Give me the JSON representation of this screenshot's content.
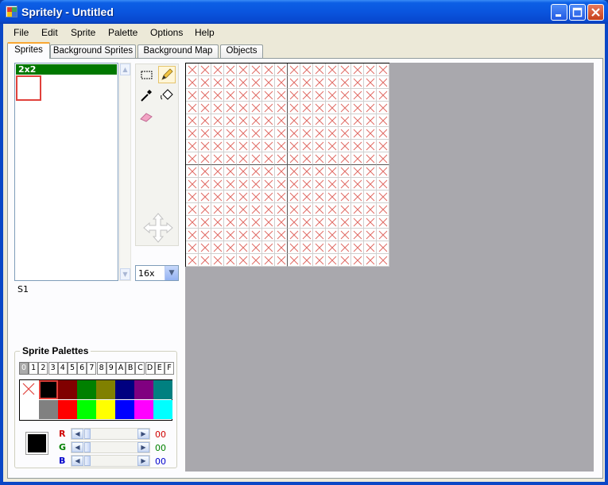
{
  "window": {
    "title": "Spritely - Untitled"
  },
  "menu": [
    "File",
    "Edit",
    "Sprite",
    "Palette",
    "Options",
    "Help"
  ],
  "tabs": [
    "Sprites",
    "Background Sprites",
    "Background Map",
    "Objects"
  ],
  "sprite_list": {
    "header": "2x2",
    "caption": "S1"
  },
  "zoom": {
    "value": "16x"
  },
  "palettes": {
    "title": "Sprite Palettes",
    "indices": [
      "0",
      "1",
      "2",
      "3",
      "4",
      "5",
      "6",
      "7",
      "8",
      "9",
      "A",
      "B",
      "C",
      "D",
      "E",
      "F"
    ],
    "selected_index": "0",
    "colors_row1": [
      "transparent",
      "#000000",
      "#800000",
      "#008000",
      "#808000",
      "#000080",
      "#800080",
      "#008080"
    ],
    "colors_row2": [
      "none",
      "#808080",
      "#ff0000",
      "#00ff00",
      "#ffff00",
      "#0000ff",
      "#ff00ff",
      "#00ffff"
    ]
  },
  "color_editor": {
    "current": "#000000",
    "r_label": "R",
    "g_label": "G",
    "b_label": "B",
    "r_value": "00",
    "g_value": "00",
    "b_value": "00",
    "r_color": "#d00000",
    "g_color": "#008000",
    "b_color": "#0000cc"
  },
  "icons": {
    "select": "marquee-select-icon",
    "pencil": "pencil-icon",
    "eyedropper": "eyedropper-icon",
    "fill": "paint-bucket-icon",
    "eraser": "eraser-icon",
    "move": "move-arrows-icon"
  }
}
